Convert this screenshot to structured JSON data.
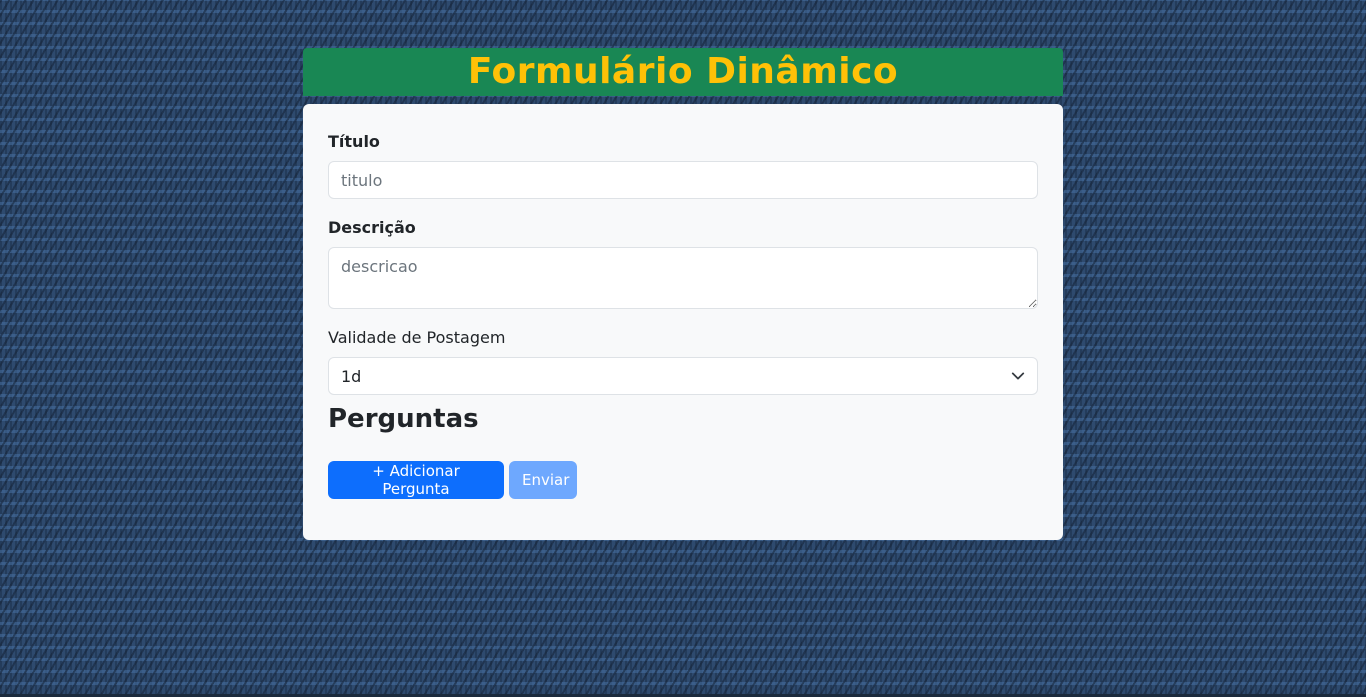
{
  "header": {
    "title": "Formulário Dinâmico"
  },
  "form": {
    "title_label": "Título",
    "title_placeholder": "titulo",
    "description_label": "Descrição",
    "description_placeholder": "descricao",
    "validity_label": "Validade de Postagem",
    "validity_selected": "1d",
    "questions_heading": "Perguntas",
    "add_question_button": "+ Adicionar Pergunta",
    "submit_button": "Enviar"
  },
  "icons": {
    "select_arrow": "chevron-down-icon"
  },
  "colors": {
    "header_bg": "#198754",
    "header_text": "#ffc107",
    "primary_button": "#0d6efd",
    "disabled_button": "#6ea8fe",
    "card_bg": "#f8f9fa"
  }
}
